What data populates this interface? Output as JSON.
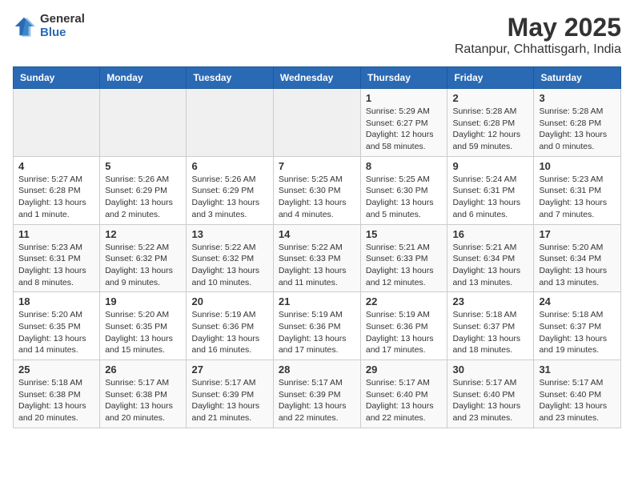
{
  "logo": {
    "general": "General",
    "blue": "Blue"
  },
  "title": {
    "month_year": "May 2025",
    "location": "Ratanpur, Chhattisgarh, India"
  },
  "weekdays": [
    "Sunday",
    "Monday",
    "Tuesday",
    "Wednesday",
    "Thursday",
    "Friday",
    "Saturday"
  ],
  "weeks": [
    [
      {
        "day": "",
        "info": ""
      },
      {
        "day": "",
        "info": ""
      },
      {
        "day": "",
        "info": ""
      },
      {
        "day": "",
        "info": ""
      },
      {
        "day": "1",
        "info": "Sunrise: 5:29 AM\nSunset: 6:27 PM\nDaylight: 12 hours\nand 58 minutes."
      },
      {
        "day": "2",
        "info": "Sunrise: 5:28 AM\nSunset: 6:28 PM\nDaylight: 12 hours\nand 59 minutes."
      },
      {
        "day": "3",
        "info": "Sunrise: 5:28 AM\nSunset: 6:28 PM\nDaylight: 13 hours\nand 0 minutes."
      }
    ],
    [
      {
        "day": "4",
        "info": "Sunrise: 5:27 AM\nSunset: 6:28 PM\nDaylight: 13 hours\nand 1 minute."
      },
      {
        "day": "5",
        "info": "Sunrise: 5:26 AM\nSunset: 6:29 PM\nDaylight: 13 hours\nand 2 minutes."
      },
      {
        "day": "6",
        "info": "Sunrise: 5:26 AM\nSunset: 6:29 PM\nDaylight: 13 hours\nand 3 minutes."
      },
      {
        "day": "7",
        "info": "Sunrise: 5:25 AM\nSunset: 6:30 PM\nDaylight: 13 hours\nand 4 minutes."
      },
      {
        "day": "8",
        "info": "Sunrise: 5:25 AM\nSunset: 6:30 PM\nDaylight: 13 hours\nand 5 minutes."
      },
      {
        "day": "9",
        "info": "Sunrise: 5:24 AM\nSunset: 6:31 PM\nDaylight: 13 hours\nand 6 minutes."
      },
      {
        "day": "10",
        "info": "Sunrise: 5:23 AM\nSunset: 6:31 PM\nDaylight: 13 hours\nand 7 minutes."
      }
    ],
    [
      {
        "day": "11",
        "info": "Sunrise: 5:23 AM\nSunset: 6:31 PM\nDaylight: 13 hours\nand 8 minutes."
      },
      {
        "day": "12",
        "info": "Sunrise: 5:22 AM\nSunset: 6:32 PM\nDaylight: 13 hours\nand 9 minutes."
      },
      {
        "day": "13",
        "info": "Sunrise: 5:22 AM\nSunset: 6:32 PM\nDaylight: 13 hours\nand 10 minutes."
      },
      {
        "day": "14",
        "info": "Sunrise: 5:22 AM\nSunset: 6:33 PM\nDaylight: 13 hours\nand 11 minutes."
      },
      {
        "day": "15",
        "info": "Sunrise: 5:21 AM\nSunset: 6:33 PM\nDaylight: 13 hours\nand 12 minutes."
      },
      {
        "day": "16",
        "info": "Sunrise: 5:21 AM\nSunset: 6:34 PM\nDaylight: 13 hours\nand 13 minutes."
      },
      {
        "day": "17",
        "info": "Sunrise: 5:20 AM\nSunset: 6:34 PM\nDaylight: 13 hours\nand 13 minutes."
      }
    ],
    [
      {
        "day": "18",
        "info": "Sunrise: 5:20 AM\nSunset: 6:35 PM\nDaylight: 13 hours\nand 14 minutes."
      },
      {
        "day": "19",
        "info": "Sunrise: 5:20 AM\nSunset: 6:35 PM\nDaylight: 13 hours\nand 15 minutes."
      },
      {
        "day": "20",
        "info": "Sunrise: 5:19 AM\nSunset: 6:36 PM\nDaylight: 13 hours\nand 16 minutes."
      },
      {
        "day": "21",
        "info": "Sunrise: 5:19 AM\nSunset: 6:36 PM\nDaylight: 13 hours\nand 17 minutes."
      },
      {
        "day": "22",
        "info": "Sunrise: 5:19 AM\nSunset: 6:36 PM\nDaylight: 13 hours\nand 17 minutes."
      },
      {
        "day": "23",
        "info": "Sunrise: 5:18 AM\nSunset: 6:37 PM\nDaylight: 13 hours\nand 18 minutes."
      },
      {
        "day": "24",
        "info": "Sunrise: 5:18 AM\nSunset: 6:37 PM\nDaylight: 13 hours\nand 19 minutes."
      }
    ],
    [
      {
        "day": "25",
        "info": "Sunrise: 5:18 AM\nSunset: 6:38 PM\nDaylight: 13 hours\nand 20 minutes."
      },
      {
        "day": "26",
        "info": "Sunrise: 5:17 AM\nSunset: 6:38 PM\nDaylight: 13 hours\nand 20 minutes."
      },
      {
        "day": "27",
        "info": "Sunrise: 5:17 AM\nSunset: 6:39 PM\nDaylight: 13 hours\nand 21 minutes."
      },
      {
        "day": "28",
        "info": "Sunrise: 5:17 AM\nSunset: 6:39 PM\nDaylight: 13 hours\nand 22 minutes."
      },
      {
        "day": "29",
        "info": "Sunrise: 5:17 AM\nSunset: 6:40 PM\nDaylight: 13 hours\nand 22 minutes."
      },
      {
        "day": "30",
        "info": "Sunrise: 5:17 AM\nSunset: 6:40 PM\nDaylight: 13 hours\nand 23 minutes."
      },
      {
        "day": "31",
        "info": "Sunrise: 5:17 AM\nSunset: 6:40 PM\nDaylight: 13 hours\nand 23 minutes."
      }
    ]
  ]
}
